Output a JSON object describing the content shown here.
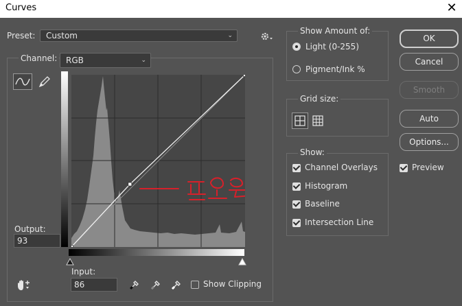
{
  "window": {
    "title": "Curves",
    "close_glyph": "✕"
  },
  "preset": {
    "label": "Preset:",
    "value": "Custom"
  },
  "channel": {
    "label": "Channel:",
    "value": "RGB"
  },
  "output": {
    "label": "Output:",
    "value": "93"
  },
  "input": {
    "label": "Input:",
    "value": "86"
  },
  "show_clipping": {
    "label": "Show Clipping",
    "checked": false
  },
  "show_amount": {
    "legend": "Show Amount of:",
    "options": [
      {
        "label": "Light  (0-255)",
        "selected": true
      },
      {
        "label": "Pigment/Ink %",
        "selected": false
      }
    ]
  },
  "grid_size": {
    "legend": "Grid size:"
  },
  "show": {
    "legend": "Show:",
    "options": [
      {
        "label": "Channel Overlays",
        "checked": true
      },
      {
        "label": "Histogram",
        "checked": true
      },
      {
        "label": "Baseline",
        "checked": true
      },
      {
        "label": "Intersection Line",
        "checked": true
      }
    ]
  },
  "buttons": {
    "ok": "OK",
    "cancel": "Cancel",
    "smooth": "Smooth",
    "auto": "Auto",
    "options": "Options..."
  },
  "preview": {
    "label": "Preview",
    "checked": true
  },
  "annotation": {
    "text": "— 표이도",
    "color": "#d8202a"
  },
  "curve": {
    "control_points": [
      [
        0,
        0
      ],
      [
        86,
        93
      ],
      [
        255,
        255
      ]
    ]
  },
  "colors": {
    "background": "#535353",
    "graph": "#464646",
    "histogram": "#8a8a8a"
  }
}
